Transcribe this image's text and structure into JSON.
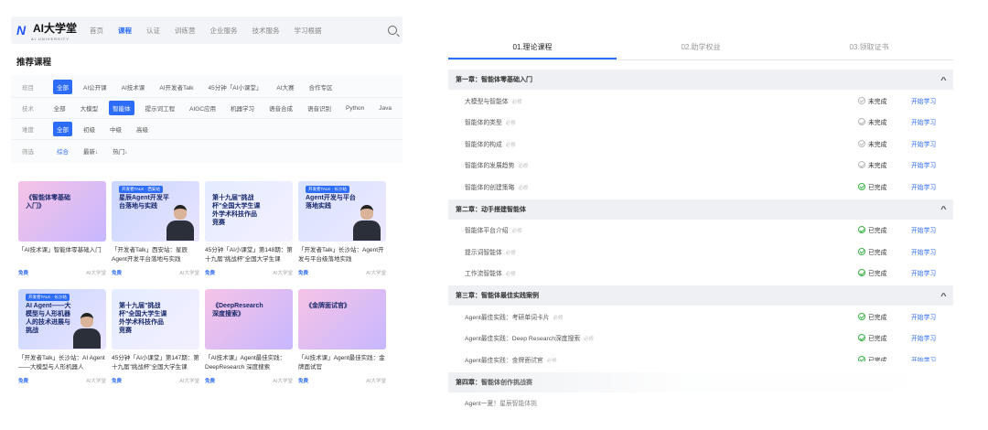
{
  "nav": {
    "logo_mark": "N",
    "logo_text": "AI大学堂",
    "logo_sub": "AI UNIVERSITY",
    "items": [
      "首页",
      "课程",
      "认证",
      "训练营",
      "企业服务",
      "技术服务",
      "学习根据"
    ],
    "active_index": 1
  },
  "section_title": "推荐课程",
  "filters": [
    {
      "label": "班目",
      "chips": [
        "全部",
        "AI公开课",
        "AI技术课",
        "AI开发者Talk",
        "45分钟「AI小课堂」",
        "AI大赛",
        "合作专区"
      ],
      "active": 0
    },
    {
      "label": "技术",
      "chips": [
        "全部",
        "大模型",
        "智能体",
        "提示词工程",
        "AIGC应用",
        "机器学习",
        "语音合成",
        "语音识别",
        "Python",
        "Java"
      ],
      "active": 2
    },
    {
      "label": "难度",
      "chips": [
        "全部",
        "初级",
        "中级",
        "高级"
      ],
      "active": 0
    },
    {
      "label": "筛选",
      "chips": [
        "综合",
        "最新↓",
        "热门↓"
      ],
      "active_link": 0
    }
  ],
  "cards": [
    {
      "badge": "",
      "thumb_text": "《智能体零基础入门》",
      "title": "「AI技术课」智能体零基础入门",
      "price": "免费",
      "org": "AI大学堂",
      "style": "t1",
      "person": false
    },
    {
      "badge": "开发者TALK · 西安站",
      "thumb_text": "星辰Agent开发平台落地与实践",
      "title": "「开发者Talk」西安站：星辰Agent开发平台落地与实践",
      "price": "免费",
      "org": "AI大学堂",
      "style": "t2",
      "person": true
    },
    {
      "badge": "",
      "thumb_text": "第十九届\"挑战杯\"全国大学生课外学术科技作品竞赛",
      "title": "45分钟「AI小课堂」第148期：第十九届\"挑战杯\"全国大学生课",
      "price": "免费",
      "org": "AI大学堂",
      "style": "t3",
      "person": false
    },
    {
      "badge": "开发者TALK · 长沙站",
      "thumb_text": "Agent开发与平台落地实践",
      "title": "「开发者Talk」长沙站：Agent开发与平台级落地实践",
      "price": "免费",
      "org": "AI大学堂",
      "style": "t4",
      "person": true
    },
    {
      "badge": "开发者TALK · 长沙站",
      "thumb_text": "AI Agent——大模型与人形机器人的技术进展与挑战",
      "title": "「开发者Talk」长沙站：AI Agent——大模型与人形机器人",
      "price": "免费",
      "org": "AI大学堂",
      "style": "t2",
      "person": true
    },
    {
      "badge": "",
      "thumb_text": "第十九届\"挑战杯\"全国大学生课外学术科技作品竞赛",
      "title": "45分钟「AI小课堂」第147期：第十九届\"挑战杯\"全国大学生课",
      "price": "免费",
      "org": "AI大学堂",
      "style": "t3",
      "person": false
    },
    {
      "badge": "",
      "thumb_text": "《DeepResearch深度搜索》",
      "title": "「AI技术课」Agent最佳实践：DeepResearch 深度搜索",
      "price": "免费",
      "org": "AI大学堂",
      "style": "t1",
      "person": false
    },
    {
      "badge": "",
      "thumb_text": "《金牌面试官》",
      "title": "「AI技术课」Agent最佳实践：金牌面试官",
      "price": "免费",
      "org": "AI大学堂",
      "style": "t1",
      "person": false
    }
  ],
  "tabs": [
    "01.理论课程",
    "02.助学权益",
    "03.领取证书"
  ],
  "active_tab": 0,
  "chapters": [
    {
      "title": "第一章：智能体零基础入门",
      "lessons": [
        {
          "name": "大模型与智能体",
          "req": "必修",
          "status": "未完成",
          "done": false,
          "action": "开始学习"
        },
        {
          "name": "智能体的类型",
          "req": "必修",
          "status": "未完成",
          "done": false,
          "action": "开始学习"
        },
        {
          "name": "智能体的构成",
          "req": "必修",
          "status": "未完成",
          "done": false,
          "action": "开始学习"
        },
        {
          "name": "智能体的发展趋势",
          "req": "必修",
          "status": "未完成",
          "done": false,
          "action": "开始学习"
        },
        {
          "name": "智能体的创建策略",
          "req": "必修",
          "status": "已完成",
          "done": true,
          "action": "开始学习"
        }
      ]
    },
    {
      "title": "第二章：动手搭建智能体",
      "lessons": [
        {
          "name": "智能体平台介绍",
          "req": "必修",
          "status": "已完成",
          "done": true,
          "action": "开始学习"
        },
        {
          "name": "提示词智能体",
          "req": "必修",
          "status": "已完成",
          "done": true,
          "action": "开始学习"
        },
        {
          "name": "工作流智能体",
          "req": "必修",
          "status": "已完成",
          "done": true,
          "action": "开始学习"
        }
      ]
    },
    {
      "title": "第三章：智能体最佳实践案例",
      "lessons": [
        {
          "name": "Agent最佳实践：考研单词卡片",
          "req": "必修",
          "status": "已完成",
          "done": true,
          "action": "开始学习"
        },
        {
          "name": "Agent最佳实践：Deep Research深度搜索",
          "req": "必修",
          "status": "已完成",
          "done": true,
          "action": "开始学习"
        },
        {
          "name": "Agent最佳实践：金牌面试官",
          "req": "必修",
          "status": "已完成",
          "done": true,
          "action": "开始学习"
        }
      ]
    },
    {
      "title": "第四章：智能体创作挑战赛",
      "lessons": [
        {
          "name": "Agent一夏！星辰智能体挑",
          "req": "",
          "status": "",
          "done": false,
          "action": ""
        }
      ]
    }
  ],
  "colors": {
    "accent": "#2d6cf6",
    "done": "#3bb54a",
    "chapter_bg": "#eef0f3"
  }
}
